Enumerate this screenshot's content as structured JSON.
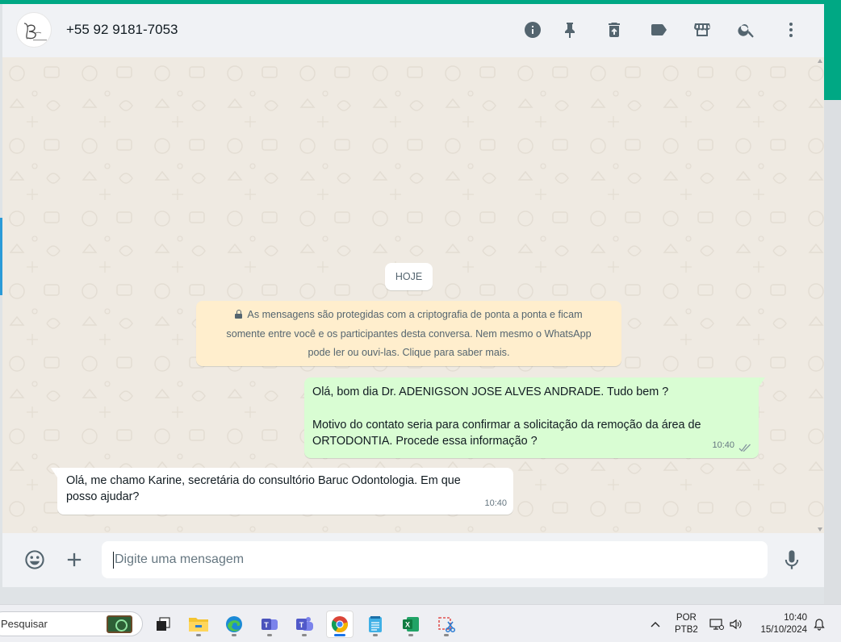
{
  "header": {
    "contact_name": "+55 92 9181-7053",
    "icons": [
      "info-icon",
      "pin-icon",
      "delete-icon",
      "label-icon",
      "store-icon",
      "search-icon",
      "menu-dots-icon"
    ]
  },
  "chat": {
    "date_label": "HOJE",
    "encryption_notice": {
      "line1": "As mensagens são protegidas com a criptografia de ponta a ponta e ficam",
      "line2": "somente entre você e os participantes desta conversa. Nem mesmo o WhatsApp",
      "line3": "pode ler ou ouvi-las. Clique para saber mais."
    },
    "messages": [
      {
        "direction": "outgoing",
        "line1": "Olá, bom dia Dr. ADENIGSON JOSE ALVES ANDRADE. Tudo bem ?",
        "line2": "Motivo do contato seria para confirmar a solicitação da remoção da área de",
        "line3": "ORTODONTIA. Procede essa informação ?",
        "time": "10:40",
        "status": "double-check"
      },
      {
        "direction": "incoming",
        "line1": "Olá, me chamo Karine, secretária do consultório Baruc Odontologia. Em que",
        "line2": "posso ajudar?",
        "time": "10:40"
      }
    ]
  },
  "composer": {
    "placeholder": "Digite uma mensagem",
    "value": "",
    "icons": [
      "emoji-icon",
      "plus-icon",
      "microphone-icon"
    ]
  },
  "taskbar": {
    "search_placeholder": "Pesquisar",
    "apps": [
      "task-view",
      "file-explorer",
      "edge",
      "teams-work",
      "teams",
      "chrome",
      "notepad",
      "excel",
      "snipping-tool"
    ],
    "active_app": "chrome",
    "language_line1": "POR",
    "language_line2": "PTB2",
    "clock_time": "10:40",
    "clock_date": "15/10/2024"
  },
  "colors": {
    "accent": "#00a884",
    "header_bg": "#f0f2f5",
    "chat_bg": "#efeae2",
    "outgoing_bubble": "#d9fdd3",
    "incoming_bubble": "#ffffff",
    "notice_bg": "#ffeecd",
    "read_ticks": "#8696a0"
  }
}
